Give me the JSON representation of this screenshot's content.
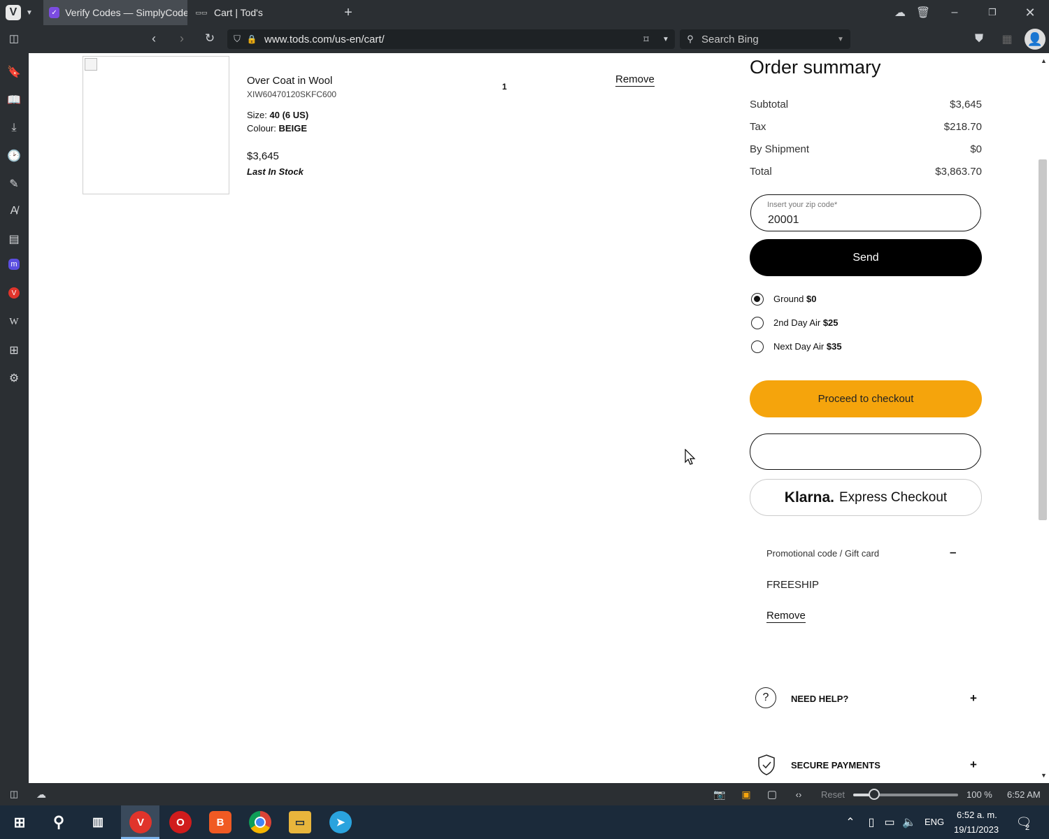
{
  "browser": {
    "tabs": [
      {
        "title": "Verify Codes — SimplyCodes",
        "active": true
      },
      {
        "title": "Cart | Tod's",
        "active": false
      }
    ],
    "url": "www.tods.com/us-en/cart/",
    "search_placeholder": "Search Bing"
  },
  "cart": {
    "item": {
      "name": "Over Coat in Wool",
      "sku": "XIW60470120SKFC600",
      "size_label": "Size:",
      "size_value": "40 (6 US)",
      "colour_label": "Colour:",
      "colour_value": "BEIGE",
      "price": "$3,645",
      "stock": "Last In Stock",
      "quantity": "1",
      "remove_label": "Remove"
    }
  },
  "summary": {
    "title": "Order summary",
    "rows": [
      {
        "label": "Subtotal",
        "value": "$3,645"
      },
      {
        "label": "Tax",
        "value": "$218.70"
      },
      {
        "label": "By Shipment",
        "value": "$0"
      },
      {
        "label": "Total",
        "value": "$3,863.70"
      }
    ],
    "zip_label": "Insert your zip code*",
    "zip_value": "20001",
    "send_label": "Send",
    "shipping": [
      {
        "label": "Ground",
        "price": "$0",
        "selected": true
      },
      {
        "label": "2nd Day Air",
        "price": "$25",
        "selected": false
      },
      {
        "label": "Next Day Air",
        "price": "$35",
        "selected": false
      }
    ],
    "checkout_label": "Proceed to checkout",
    "klarna_brand": "Klarna.",
    "klarna_label": "Express Checkout",
    "promo_title": "Promotional code / Gift card",
    "promo_toggle": "–",
    "promo_code": "FREESHIP",
    "promo_remove": "Remove",
    "help_label": "NEED HELP?",
    "secure_label": "SECURE PAYMENTS",
    "expand": "+",
    "accent": "#f5a40c"
  },
  "statusbar": {
    "reset": "Reset",
    "zoom": "100 %",
    "time": "6:52 AM",
    "zoom_fraction": 0.2
  },
  "taskbar": {
    "lang": "ENG",
    "time": "6:52 a. m.",
    "date": "19/11/2023",
    "notifications": "2"
  }
}
